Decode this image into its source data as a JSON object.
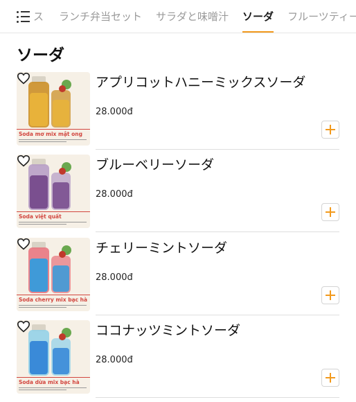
{
  "tabs": [
    {
      "label": "ス",
      "active": false
    },
    {
      "label": "ランチ弁当セット",
      "active": false
    },
    {
      "label": "サラダと味噌汁",
      "active": false
    },
    {
      "label": "ソーダ",
      "active": true
    },
    {
      "label": "フルーツティー",
      "active": false
    }
  ],
  "section_title": "ソーダ",
  "items": [
    {
      "name": "アプリコットハニーミックスソーダ",
      "price": "28.000đ",
      "thumb_caption": "Soda mơ mix mật ong",
      "liquid": "#e8b23a",
      "liquid2": "#c98a1c"
    },
    {
      "name": "ブルーベリーソーダ",
      "price": "28.000đ",
      "thumb_caption": "Soda việt quất",
      "liquid": "#7a4f8f",
      "liquid2": "#b49ac4"
    },
    {
      "name": "チェリーミントソーダ",
      "price": "28.000đ",
      "thumb_caption": "Soda cherry mix bạc hà",
      "liquid": "#3f9ad8",
      "liquid2": "#e8707a"
    },
    {
      "name": "ココナッツミントソーダ",
      "price": "28.000đ",
      "thumb_caption": "Soda dừa mix bạc hà",
      "liquid": "#3a8ad8",
      "liquid2": "#8ed0e8"
    }
  ],
  "colors": {
    "accent": "#f29a1d",
    "caption": "#d2463f"
  },
  "icons": {
    "menu": "list-menu-icon",
    "favorite": "heart-outline-icon",
    "add": "plus-icon"
  }
}
